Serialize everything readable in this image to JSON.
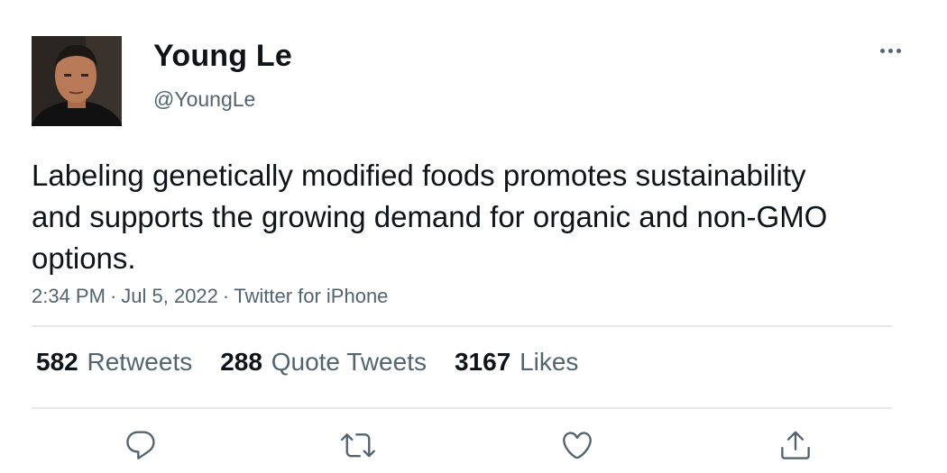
{
  "user": {
    "display_name": "Young Le",
    "handle": "@YoungLe"
  },
  "tweet": {
    "text": "Labeling genetically modified foods promotes sustainability and supports the growing demand for organic and non-GMO options.",
    "time": "2:34 PM",
    "date": "Jul 5, 2022",
    "source": "Twitter for iPhone",
    "separator": "·"
  },
  "stats": {
    "retweets": {
      "count": "582",
      "label": "Retweets"
    },
    "quote_tweets": {
      "count": "288",
      "label": "Quote Tweets"
    },
    "likes": {
      "count": "3167",
      "label": "Likes"
    }
  },
  "actions": {
    "icons": [
      "reply-icon",
      "retweet-icon",
      "like-icon",
      "share-icon"
    ]
  },
  "colors": {
    "text_primary": "#0f1419",
    "text_secondary": "#536471",
    "divider": "#e6e9eb",
    "background": "#ffffff"
  }
}
